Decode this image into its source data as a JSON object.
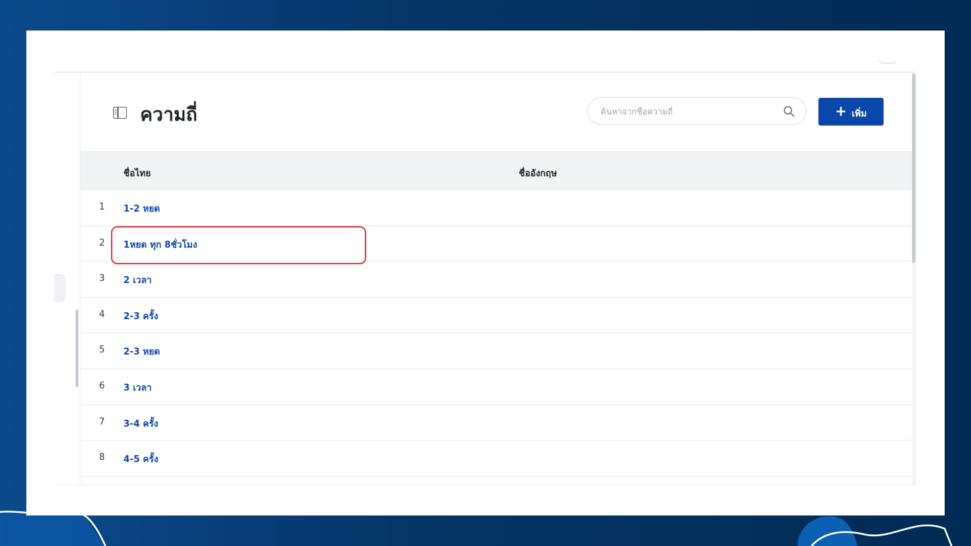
{
  "page": {
    "title": "ความถี่"
  },
  "search": {
    "placeholder": "ค้นหาจากชื่อความถี่",
    "value": ""
  },
  "toolbar": {
    "add_icon": "+",
    "add_label": "เพิ่ม"
  },
  "table": {
    "columns": {
      "thai": "ชื่อไทย",
      "english": "ชื่ออังกฤษ"
    },
    "rows": [
      {
        "index": "1",
        "thai": "1-2 หยด",
        "english": ""
      },
      {
        "index": "2",
        "thai": "1หยด ทุก 8ชั่วโมง",
        "english": ""
      },
      {
        "index": "3",
        "thai": "2 เวลา",
        "english": ""
      },
      {
        "index": "4",
        "thai": "2-3 ครั้ง",
        "english": ""
      },
      {
        "index": "5",
        "thai": "2-3 หยด",
        "english": ""
      },
      {
        "index": "6",
        "thai": "3 เวลา",
        "english": ""
      },
      {
        "index": "7",
        "thai": "3-4 ครั้ง",
        "english": ""
      },
      {
        "index": "8",
        "thai": "4-5 ครั้ง",
        "english": ""
      }
    ],
    "highlighted_row": "2"
  },
  "icons": {
    "title": "book-open-icon",
    "search": "search-icon",
    "add": "plus-icon"
  },
  "colors": {
    "background": "#053465",
    "primary": "#0b47a8",
    "link": "#0b47a8",
    "highlight": "#e4373d",
    "header_row": "#f2f3f5"
  }
}
